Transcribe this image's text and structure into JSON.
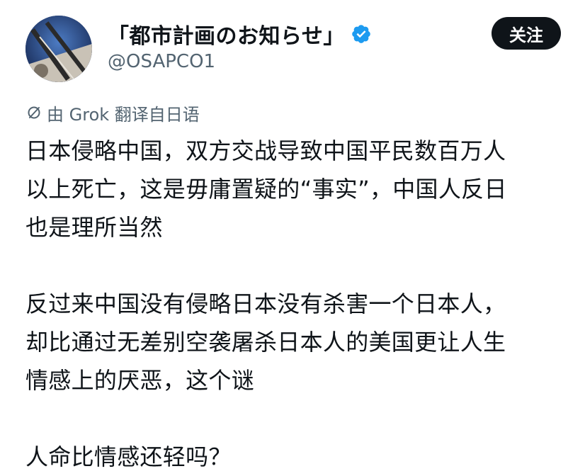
{
  "account": {
    "display_name": "「都市計画のお知らせ」",
    "handle": "@OSAPCO1",
    "verified": true,
    "accent_color": "#1d9bf0"
  },
  "actions": {
    "follow_label": "关注"
  },
  "translation": {
    "note": "由 Grok 翻译自日语",
    "icon": "translate-icon"
  },
  "post": {
    "paragraphs": [
      [
        "日本侵略中国，双方交战导致中国平民数百万人",
        "以上死亡，这是毋庸置疑的“事实”，中国人反日",
        "也是理所当然"
      ],
      [
        "反过来中国没有侵略日本没有杀害一个日本人，",
        "却比通过无差别空袭屠杀日本人的美国更让人生",
        "情感上的厌恶，这个谜"
      ],
      [
        "人命比情感还轻吗？"
      ]
    ]
  }
}
